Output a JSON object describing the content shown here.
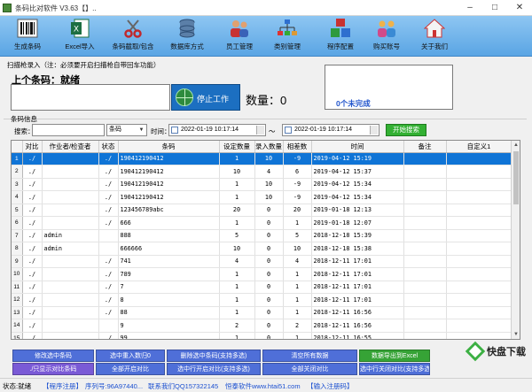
{
  "window": {
    "title": "条码比对软件 V3.63【】..",
    "controls": [
      "–",
      "□",
      "✕"
    ]
  },
  "toolbar": {
    "items": [
      {
        "label": "生成条码",
        "icon": "barcode-icon"
      },
      {
        "label": "Excel导入",
        "icon": "excel-icon"
      },
      {
        "label": "条码截取/包含",
        "icon": "scissors-icon"
      },
      {
        "label": "数据库方式",
        "icon": "database-icon"
      },
      {
        "label": "员工管理",
        "icon": "users-icon"
      },
      {
        "label": "类别管理",
        "icon": "hierarchy-icon"
      },
      {
        "label": "程序配置",
        "icon": "cubes-icon"
      },
      {
        "label": "购买账号",
        "icon": "people-icon"
      },
      {
        "label": "关于我们",
        "icon": "home-icon"
      }
    ]
  },
  "scan": {
    "caption": "扫描枪录入（注：必须要开启扫描枪自带回车功能）",
    "last_code_label": "上个条码：就绪",
    "stop_button": "停止工作",
    "qty_label": "数量：0",
    "incomplete_text": "0个未完成"
  },
  "section": {
    "title": "条码信息"
  },
  "search": {
    "label": "搜索：",
    "value": "",
    "field_value": "条码",
    "time_label": "时间：",
    "start_time": "2022-01-19 10:17:14",
    "tilde": "～",
    "end_time": "2022-01-19 10:17:14",
    "button": "开始搜索"
  },
  "table": {
    "columns": [
      "对比",
      "作业者/检查者",
      "状态",
      "条码",
      "设定数量",
      "录入数量",
      "相差数",
      "时间",
      "备注",
      "自定义1"
    ],
    "rows": [
      {
        "idx": "1",
        "compare": "./",
        "operator": "",
        "status": "./",
        "code": "190412190412",
        "set": "1",
        "entered": "10",
        "diff": "-9",
        "time": "2019-04-12 15:19",
        "selected": true
      },
      {
        "idx": "2",
        "compare": "./",
        "operator": "",
        "status": "./",
        "code": "190412190412",
        "set": "10",
        "entered": "4",
        "diff": "6",
        "time": "2019-04-12 15:37",
        "selected": false
      },
      {
        "idx": "3",
        "compare": "./",
        "operator": "",
        "status": "./",
        "code": "190412190412",
        "set": "1",
        "entered": "10",
        "diff": "-9",
        "time": "2019-04-12 15:34",
        "selected": false
      },
      {
        "idx": "4",
        "compare": "./",
        "operator": "",
        "status": "./",
        "code": "190412190412",
        "set": "1",
        "entered": "10",
        "diff": "-9",
        "time": "2019-04-12 15:34",
        "selected": false
      },
      {
        "idx": "5",
        "compare": "./",
        "operator": "",
        "status": "./",
        "code": "123456789abc",
        "set": "20",
        "entered": "0",
        "diff": "20",
        "time": "2019-01-18 12:13",
        "selected": false
      },
      {
        "idx": "6",
        "compare": "./",
        "operator": "",
        "status": "./",
        "code": "666",
        "set": "1",
        "entered": "0",
        "diff": "1",
        "time": "2019-01-18 12:07",
        "selected": false
      },
      {
        "idx": "7",
        "compare": "./",
        "operator": "admin",
        "status": "",
        "code": "888",
        "set": "5",
        "entered": "0",
        "diff": "5",
        "time": "2018-12-18 15:39",
        "selected": false
      },
      {
        "idx": "8",
        "compare": "./",
        "operator": "admin",
        "status": "",
        "code": "666666",
        "set": "10",
        "entered": "0",
        "diff": "10",
        "time": "2018-12-18 15:38",
        "selected": false
      },
      {
        "idx": "9",
        "compare": "./",
        "operator": "",
        "status": "./",
        "code": "741",
        "set": "4",
        "entered": "0",
        "diff": "4",
        "time": "2018-12-11 17:01",
        "selected": false
      },
      {
        "idx": "10",
        "compare": "./",
        "operator": "",
        "status": "./",
        "code": "789",
        "set": "1",
        "entered": "0",
        "diff": "1",
        "time": "2018-12-11 17:01",
        "selected": false
      },
      {
        "idx": "11",
        "compare": "./",
        "operator": "",
        "status": "./",
        "code": "7",
        "set": "1",
        "entered": "0",
        "diff": "1",
        "time": "2018-12-11 17:01",
        "selected": false
      },
      {
        "idx": "12",
        "compare": "./",
        "operator": "",
        "status": "./",
        "code": "8",
        "set": "1",
        "entered": "0",
        "diff": "1",
        "time": "2018-12-11 17:01",
        "selected": false
      },
      {
        "idx": "13",
        "compare": "./",
        "operator": "",
        "status": "./",
        "code": "88",
        "set": "1",
        "entered": "0",
        "diff": "1",
        "time": "2018-12-11 16:56",
        "selected": false
      },
      {
        "idx": "14",
        "compare": "./",
        "operator": "",
        "status": "",
        "code": "9",
        "set": "2",
        "entered": "0",
        "diff": "2",
        "time": "2018-12-11 16:56",
        "selected": false
      },
      {
        "idx": "15",
        "compare": "./",
        "operator": "",
        "status": "./",
        "code": "99",
        "set": "1",
        "entered": "0",
        "diff": "1",
        "time": "2018-12-11 16:55",
        "selected": false
      }
    ]
  },
  "buttons": {
    "row1": [
      {
        "label": "修改选中条码",
        "color": "#4f6fd8"
      },
      {
        "label": "选中重入数归0",
        "color": "#4f6fd8"
      },
      {
        "label": "删除选中条码(支持多选)",
        "color": "#4f6fd8"
      },
      {
        "label": "清空所有数据",
        "color": "#4f6fd8"
      },
      {
        "label": "数据导出到Excel",
        "color": "#36a336"
      }
    ],
    "row2": [
      {
        "label": "./只显示对比条码",
        "color": "#7a5ad6"
      },
      {
        "label": "全部开启对比",
        "color": "#4f6fd8"
      },
      {
        "label": "选中行开启对比(支持多选)",
        "color": "#4f6fd8"
      },
      {
        "label": "全部关闭对比",
        "color": "#4f6fd8"
      },
      {
        "label": "选中行关闭对比(支持多选)",
        "color": "#4f6fd8"
      }
    ]
  },
  "status": {
    "state": "状态:就绪",
    "register": "【程序注册】",
    "serial": "序列号:96A97440...",
    "contact": "联系我们QQ157322145",
    "company": "恒泰软件www.htai51.com",
    "register_desc": "【输入注册码】"
  },
  "watermark": {
    "text": "快盘下载"
  }
}
